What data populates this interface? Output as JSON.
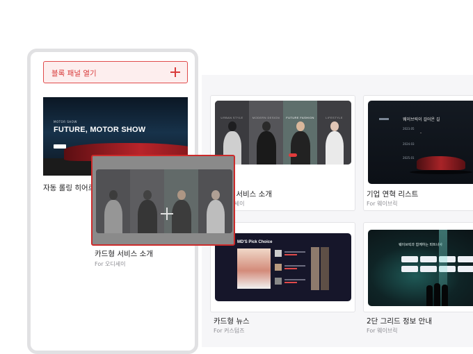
{
  "panel": {
    "open_button_label": "블록 패널 열기",
    "hero_block": {
      "small_caption": "MOTOR SHOW",
      "title": "FUTURE, MOTOR SHOW",
      "label": "자동 롤링 히어로"
    }
  },
  "dragging": {
    "title": "카드형 서비스 소개",
    "sub": "For 오디세이"
  },
  "gallery": {
    "card1": {
      "title": "카드형 서비스 소개",
      "sub": "For 오디세이",
      "captions": [
        "URBAN STYLE",
        "MODERN DESIGN",
        "FUTURE FASHION",
        "LIFESTYLE"
      ]
    },
    "card2": {
      "title": "기업 연혁 리스트",
      "sub": "For 웨이브릭",
      "heading": "웨이브릭이 걸어온 길",
      "years": [
        "2023.05",
        "2024.03",
        "2025.01"
      ]
    },
    "card3": {
      "title": "카드형 뉴스",
      "sub": "For 커스텀즈",
      "heading": "MD'S Pick Choice"
    },
    "card4": {
      "title": "2단 그리드 정보 안내",
      "sub": "For 웨이브릭",
      "heading": "웨이브릭과 함께하는 파트너사",
      "partners": [
        "Ava Robots",
        "Plan Design",
        "Sky Cloud",
        "Cloudtech",
        "Nova Inc",
        "Maxdes",
        "Flux",
        "Orbit"
      ]
    }
  }
}
